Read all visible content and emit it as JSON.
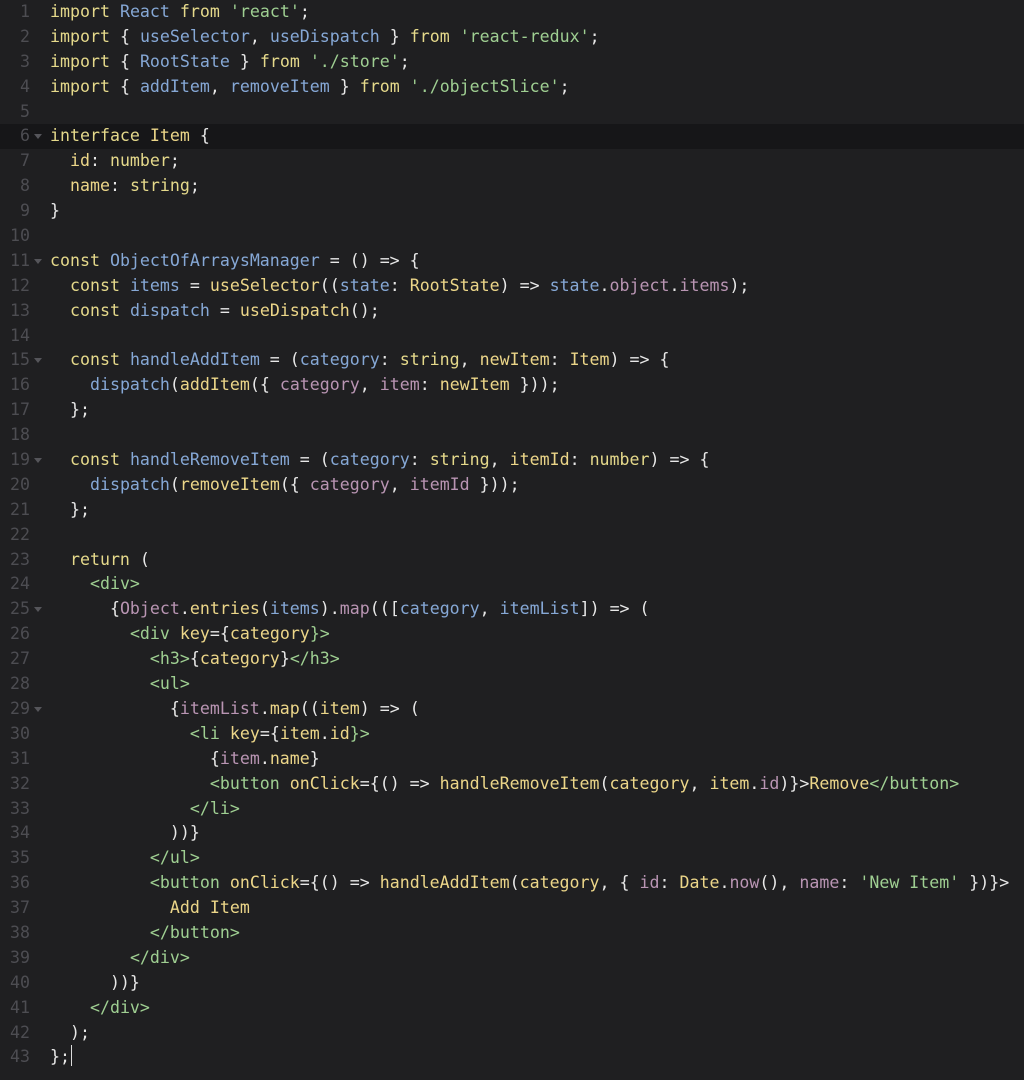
{
  "editor": {
    "current_line": 6,
    "colors": {
      "background": "#1f1f21",
      "current_line": "#161618",
      "line_number": "#4d4d52",
      "plain": "#e8e8e8",
      "keyword": "#e5d98b",
      "identifier": "#86a8d6",
      "string": "#9fcf92",
      "property": "#b995b3",
      "call": "#ecd689",
      "tag": "#9fcf92"
    },
    "lines": [
      {
        "n": "1",
        "fold": false,
        "t": [
          [
            "import",
            "keyword"
          ],
          [
            " ",
            "plain"
          ],
          [
            "React",
            "identifier"
          ],
          [
            " ",
            "plain"
          ],
          [
            "from",
            "keyword"
          ],
          [
            " ",
            "plain"
          ],
          [
            "'react'",
            "string"
          ],
          [
            ";",
            "plain"
          ]
        ]
      },
      {
        "n": "2",
        "fold": false,
        "t": [
          [
            "import",
            "keyword"
          ],
          [
            " { ",
            "plain"
          ],
          [
            "useSelector",
            "identifier"
          ],
          [
            ", ",
            "plain"
          ],
          [
            "useDispatch",
            "identifier"
          ],
          [
            " } ",
            "plain"
          ],
          [
            "from",
            "keyword"
          ],
          [
            " ",
            "plain"
          ],
          [
            "'react-redux'",
            "string"
          ],
          [
            ";",
            "plain"
          ]
        ]
      },
      {
        "n": "3",
        "fold": false,
        "t": [
          [
            "import",
            "keyword"
          ],
          [
            " { ",
            "plain"
          ],
          [
            "RootState",
            "identifier"
          ],
          [
            " } ",
            "plain"
          ],
          [
            "from",
            "keyword"
          ],
          [
            " ",
            "plain"
          ],
          [
            "'./store'",
            "string"
          ],
          [
            ";",
            "plain"
          ]
        ]
      },
      {
        "n": "4",
        "fold": false,
        "t": [
          [
            "import",
            "keyword"
          ],
          [
            " { ",
            "plain"
          ],
          [
            "addItem",
            "identifier"
          ],
          [
            ", ",
            "plain"
          ],
          [
            "removeItem",
            "identifier"
          ],
          [
            " } ",
            "plain"
          ],
          [
            "from",
            "keyword"
          ],
          [
            " ",
            "plain"
          ],
          [
            "'./objectSlice'",
            "string"
          ],
          [
            ";",
            "plain"
          ]
        ]
      },
      {
        "n": "5",
        "fold": false,
        "t": []
      },
      {
        "n": "6",
        "fold": true,
        "t": [
          [
            "interface",
            "keyword"
          ],
          [
            " ",
            "plain"
          ],
          [
            "Item",
            "call"
          ],
          [
            " {",
            "plain"
          ]
        ]
      },
      {
        "n": "7",
        "fold": false,
        "t": [
          [
            "  ",
            "plain"
          ],
          [
            "id",
            "call"
          ],
          [
            ": ",
            "plain"
          ],
          [
            "number",
            "keyword"
          ],
          [
            ";",
            "plain"
          ]
        ]
      },
      {
        "n": "8",
        "fold": false,
        "t": [
          [
            "  ",
            "plain"
          ],
          [
            "name",
            "call"
          ],
          [
            ": ",
            "plain"
          ],
          [
            "string",
            "keyword"
          ],
          [
            ";",
            "plain"
          ]
        ]
      },
      {
        "n": "9",
        "fold": false,
        "t": [
          [
            "}",
            "plain"
          ]
        ]
      },
      {
        "n": "10",
        "fold": false,
        "t": []
      },
      {
        "n": "11",
        "fold": true,
        "t": [
          [
            "const",
            "keyword"
          ],
          [
            " ",
            "plain"
          ],
          [
            "ObjectOfArraysManager",
            "identifier"
          ],
          [
            " = () => {",
            "plain"
          ]
        ]
      },
      {
        "n": "12",
        "fold": false,
        "t": [
          [
            "  ",
            "plain"
          ],
          [
            "const",
            "keyword"
          ],
          [
            " ",
            "plain"
          ],
          [
            "items",
            "identifier"
          ],
          [
            " = ",
            "plain"
          ],
          [
            "useSelector",
            "call"
          ],
          [
            "((",
            "plain"
          ],
          [
            "state",
            "identifier"
          ],
          [
            ": ",
            "plain"
          ],
          [
            "RootState",
            "call"
          ],
          [
            ") => ",
            "plain"
          ],
          [
            "state",
            "identifier"
          ],
          [
            ".",
            "plain"
          ],
          [
            "object",
            "property"
          ],
          [
            ".",
            "plain"
          ],
          [
            "items",
            "property"
          ],
          [
            ");",
            "plain"
          ]
        ]
      },
      {
        "n": "13",
        "fold": false,
        "t": [
          [
            "  ",
            "plain"
          ],
          [
            "const",
            "keyword"
          ],
          [
            " ",
            "plain"
          ],
          [
            "dispatch",
            "identifier"
          ],
          [
            " = ",
            "plain"
          ],
          [
            "useDispatch",
            "call"
          ],
          [
            "();",
            "plain"
          ]
        ]
      },
      {
        "n": "14",
        "fold": false,
        "t": []
      },
      {
        "n": "15",
        "fold": true,
        "t": [
          [
            "  ",
            "plain"
          ],
          [
            "const",
            "keyword"
          ],
          [
            " ",
            "plain"
          ],
          [
            "handleAddItem",
            "identifier"
          ],
          [
            " = (",
            "plain"
          ],
          [
            "category",
            "identifier"
          ],
          [
            ": ",
            "plain"
          ],
          [
            "string",
            "keyword"
          ],
          [
            ", ",
            "plain"
          ],
          [
            "newItem",
            "call"
          ],
          [
            ": ",
            "plain"
          ],
          [
            "Item",
            "call"
          ],
          [
            ") => {",
            "plain"
          ]
        ]
      },
      {
        "n": "16",
        "fold": false,
        "t": [
          [
            "    ",
            "plain"
          ],
          [
            "dispatch",
            "identifier"
          ],
          [
            "(",
            "plain"
          ],
          [
            "addItem",
            "call"
          ],
          [
            "({ ",
            "plain"
          ],
          [
            "category",
            "property"
          ],
          [
            ", ",
            "plain"
          ],
          [
            "item",
            "property"
          ],
          [
            ": ",
            "plain"
          ],
          [
            "newItem",
            "call"
          ],
          [
            " }));",
            "plain"
          ]
        ]
      },
      {
        "n": "17",
        "fold": false,
        "t": [
          [
            "  };",
            "plain"
          ]
        ]
      },
      {
        "n": "18",
        "fold": false,
        "t": []
      },
      {
        "n": "19",
        "fold": true,
        "t": [
          [
            "  ",
            "plain"
          ],
          [
            "const",
            "keyword"
          ],
          [
            " ",
            "plain"
          ],
          [
            "handleRemoveItem",
            "identifier"
          ],
          [
            " = (",
            "plain"
          ],
          [
            "category",
            "identifier"
          ],
          [
            ": ",
            "plain"
          ],
          [
            "string",
            "keyword"
          ],
          [
            ", ",
            "plain"
          ],
          [
            "itemId",
            "call"
          ],
          [
            ": ",
            "plain"
          ],
          [
            "number",
            "keyword"
          ],
          [
            ") => {",
            "plain"
          ]
        ]
      },
      {
        "n": "20",
        "fold": false,
        "t": [
          [
            "    ",
            "plain"
          ],
          [
            "dispatch",
            "identifier"
          ],
          [
            "(",
            "plain"
          ],
          [
            "removeItem",
            "call"
          ],
          [
            "({ ",
            "plain"
          ],
          [
            "category",
            "property"
          ],
          [
            ", ",
            "plain"
          ],
          [
            "itemId",
            "property"
          ],
          [
            " }));",
            "plain"
          ]
        ]
      },
      {
        "n": "21",
        "fold": false,
        "t": [
          [
            "  };",
            "plain"
          ]
        ]
      },
      {
        "n": "22",
        "fold": false,
        "t": []
      },
      {
        "n": "23",
        "fold": false,
        "t": [
          [
            "  ",
            "plain"
          ],
          [
            "return",
            "keyword"
          ],
          [
            " (",
            "plain"
          ]
        ]
      },
      {
        "n": "24",
        "fold": false,
        "t": [
          [
            "    ",
            "plain"
          ],
          [
            "<div>",
            "tag"
          ]
        ]
      },
      {
        "n": "25",
        "fold": true,
        "t": [
          [
            "      {",
            "plain"
          ],
          [
            "Object",
            "property"
          ],
          [
            ".",
            "plain"
          ],
          [
            "entries",
            "call"
          ],
          [
            "(",
            "plain"
          ],
          [
            "items",
            "identifier"
          ],
          [
            ").",
            "plain"
          ],
          [
            "map",
            "property"
          ],
          [
            "(([",
            "plain"
          ],
          [
            "category",
            "identifier"
          ],
          [
            ", ",
            "plain"
          ],
          [
            "itemList",
            "identifier"
          ],
          [
            "]) => (",
            "plain"
          ]
        ]
      },
      {
        "n": "26",
        "fold": false,
        "t": [
          [
            "        ",
            "plain"
          ],
          [
            "<div",
            "tag"
          ],
          [
            " ",
            "plain"
          ],
          [
            "key",
            "call"
          ],
          [
            "={",
            "plain"
          ],
          [
            "category",
            "call"
          ],
          [
            "}>",
            "tag"
          ]
        ]
      },
      {
        "n": "27",
        "fold": false,
        "t": [
          [
            "          ",
            "plain"
          ],
          [
            "<h3>",
            "tag"
          ],
          [
            "{",
            "plain"
          ],
          [
            "category",
            "call"
          ],
          [
            "}",
            "plain"
          ],
          [
            "</h3>",
            "tag"
          ]
        ]
      },
      {
        "n": "28",
        "fold": false,
        "t": [
          [
            "          ",
            "plain"
          ],
          [
            "<ul>",
            "tag"
          ]
        ]
      },
      {
        "n": "29",
        "fold": true,
        "t": [
          [
            "            {",
            "plain"
          ],
          [
            "itemList",
            "property"
          ],
          [
            ".",
            "plain"
          ],
          [
            "map",
            "call"
          ],
          [
            "((",
            "plain"
          ],
          [
            "item",
            "call"
          ],
          [
            ") => (",
            "plain"
          ]
        ]
      },
      {
        "n": "30",
        "fold": false,
        "t": [
          [
            "              ",
            "plain"
          ],
          [
            "<li",
            "tag"
          ],
          [
            " ",
            "plain"
          ],
          [
            "key",
            "call"
          ],
          [
            "={",
            "plain"
          ],
          [
            "item",
            "call"
          ],
          [
            ".",
            "plain"
          ],
          [
            "id",
            "call"
          ],
          [
            "}>",
            "tag"
          ]
        ]
      },
      {
        "n": "31",
        "fold": false,
        "t": [
          [
            "                {",
            "plain"
          ],
          [
            "item",
            "property"
          ],
          [
            ".",
            "plain"
          ],
          [
            "name",
            "call"
          ],
          [
            "}",
            "plain"
          ]
        ]
      },
      {
        "n": "32",
        "fold": false,
        "t": [
          [
            "                ",
            "plain"
          ],
          [
            "<button",
            "tag"
          ],
          [
            " ",
            "plain"
          ],
          [
            "onClick",
            "call"
          ],
          [
            "={() => ",
            "plain"
          ],
          [
            "handleRemoveItem",
            "call"
          ],
          [
            "(",
            "plain"
          ],
          [
            "category",
            "call"
          ],
          [
            ", ",
            "plain"
          ],
          [
            "item",
            "call"
          ],
          [
            ".",
            "plain"
          ],
          [
            "id",
            "property"
          ],
          [
            ")}>",
            "plain"
          ],
          [
            "Remove",
            "call"
          ],
          [
            "</button>",
            "tag"
          ]
        ]
      },
      {
        "n": "33",
        "fold": false,
        "t": [
          [
            "              ",
            "plain"
          ],
          [
            "</li>",
            "tag"
          ]
        ]
      },
      {
        "n": "34",
        "fold": false,
        "t": [
          [
            "            ))}",
            "plain"
          ]
        ]
      },
      {
        "n": "35",
        "fold": false,
        "t": [
          [
            "          ",
            "plain"
          ],
          [
            "</ul>",
            "tag"
          ]
        ]
      },
      {
        "n": "36",
        "fold": false,
        "t": [
          [
            "          ",
            "plain"
          ],
          [
            "<button",
            "tag"
          ],
          [
            " ",
            "plain"
          ],
          [
            "onClick",
            "call"
          ],
          [
            "={() => ",
            "plain"
          ],
          [
            "handleAddItem",
            "call"
          ],
          [
            "(",
            "plain"
          ],
          [
            "category",
            "call"
          ],
          [
            ", { ",
            "plain"
          ],
          [
            "id",
            "property"
          ],
          [
            ": ",
            "plain"
          ],
          [
            "Date",
            "call"
          ],
          [
            ".",
            "plain"
          ],
          [
            "now",
            "property"
          ],
          [
            "(), ",
            "plain"
          ],
          [
            "name",
            "property"
          ],
          [
            ": ",
            "plain"
          ],
          [
            "'New Item'",
            "string"
          ],
          [
            " })}>",
            "plain"
          ]
        ]
      },
      {
        "n": "37",
        "fold": false,
        "t": [
          [
            "            ",
            "plain"
          ],
          [
            "Add Item",
            "call"
          ]
        ]
      },
      {
        "n": "38",
        "fold": false,
        "t": [
          [
            "          ",
            "plain"
          ],
          [
            "</button>",
            "tag"
          ]
        ]
      },
      {
        "n": "39",
        "fold": false,
        "t": [
          [
            "        ",
            "plain"
          ],
          [
            "</div>",
            "tag"
          ]
        ]
      },
      {
        "n": "40",
        "fold": false,
        "t": [
          [
            "      ))}",
            "plain"
          ]
        ]
      },
      {
        "n": "41",
        "fold": false,
        "t": [
          [
            "    ",
            "plain"
          ],
          [
            "</div>",
            "tag"
          ]
        ]
      },
      {
        "n": "42",
        "fold": false,
        "t": [
          [
            "  );",
            "plain"
          ]
        ]
      },
      {
        "n": "43",
        "fold": false,
        "cursor": true,
        "t": [
          [
            "};",
            "plain"
          ]
        ]
      }
    ]
  }
}
